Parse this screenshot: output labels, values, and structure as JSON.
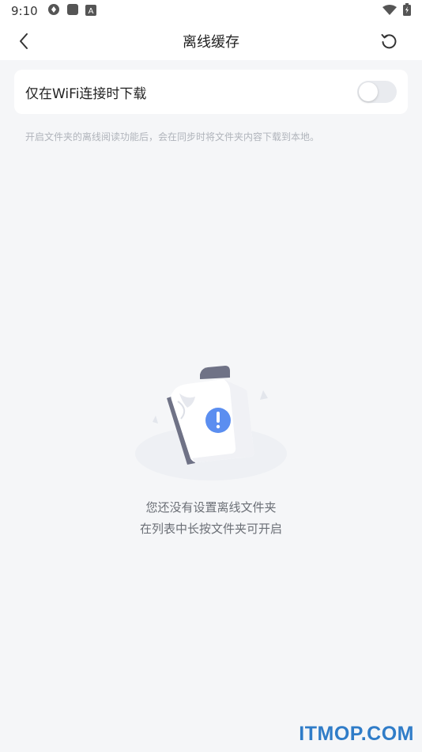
{
  "status_bar": {
    "time": "9:10",
    "left_icons": [
      "sync-icon",
      "square-icon",
      "a-icon"
    ],
    "right_icons": [
      "wifi-icon",
      "battery-icon"
    ]
  },
  "header": {
    "title": "离线缓存",
    "back_icon": "chevron-left-icon",
    "refresh_icon": "refresh-icon"
  },
  "wifi_setting": {
    "label": "仅在WiFi连接时下载",
    "enabled": false
  },
  "hint": "开启文件夹的离线阅读功能后，会在同步时将文件夹内容下载到本地。",
  "empty_state": {
    "line1": "您还没有设置离线文件夹",
    "line2": "在列表中长按文件夹可开启"
  },
  "watermark": "ITMOP.COM",
  "colors": {
    "background": "#f5f6f8",
    "card": "#ffffff",
    "toggle_off": "#e9ebef",
    "accent_blue": "#5b8ef0",
    "watermark": "#2f7cc8"
  }
}
